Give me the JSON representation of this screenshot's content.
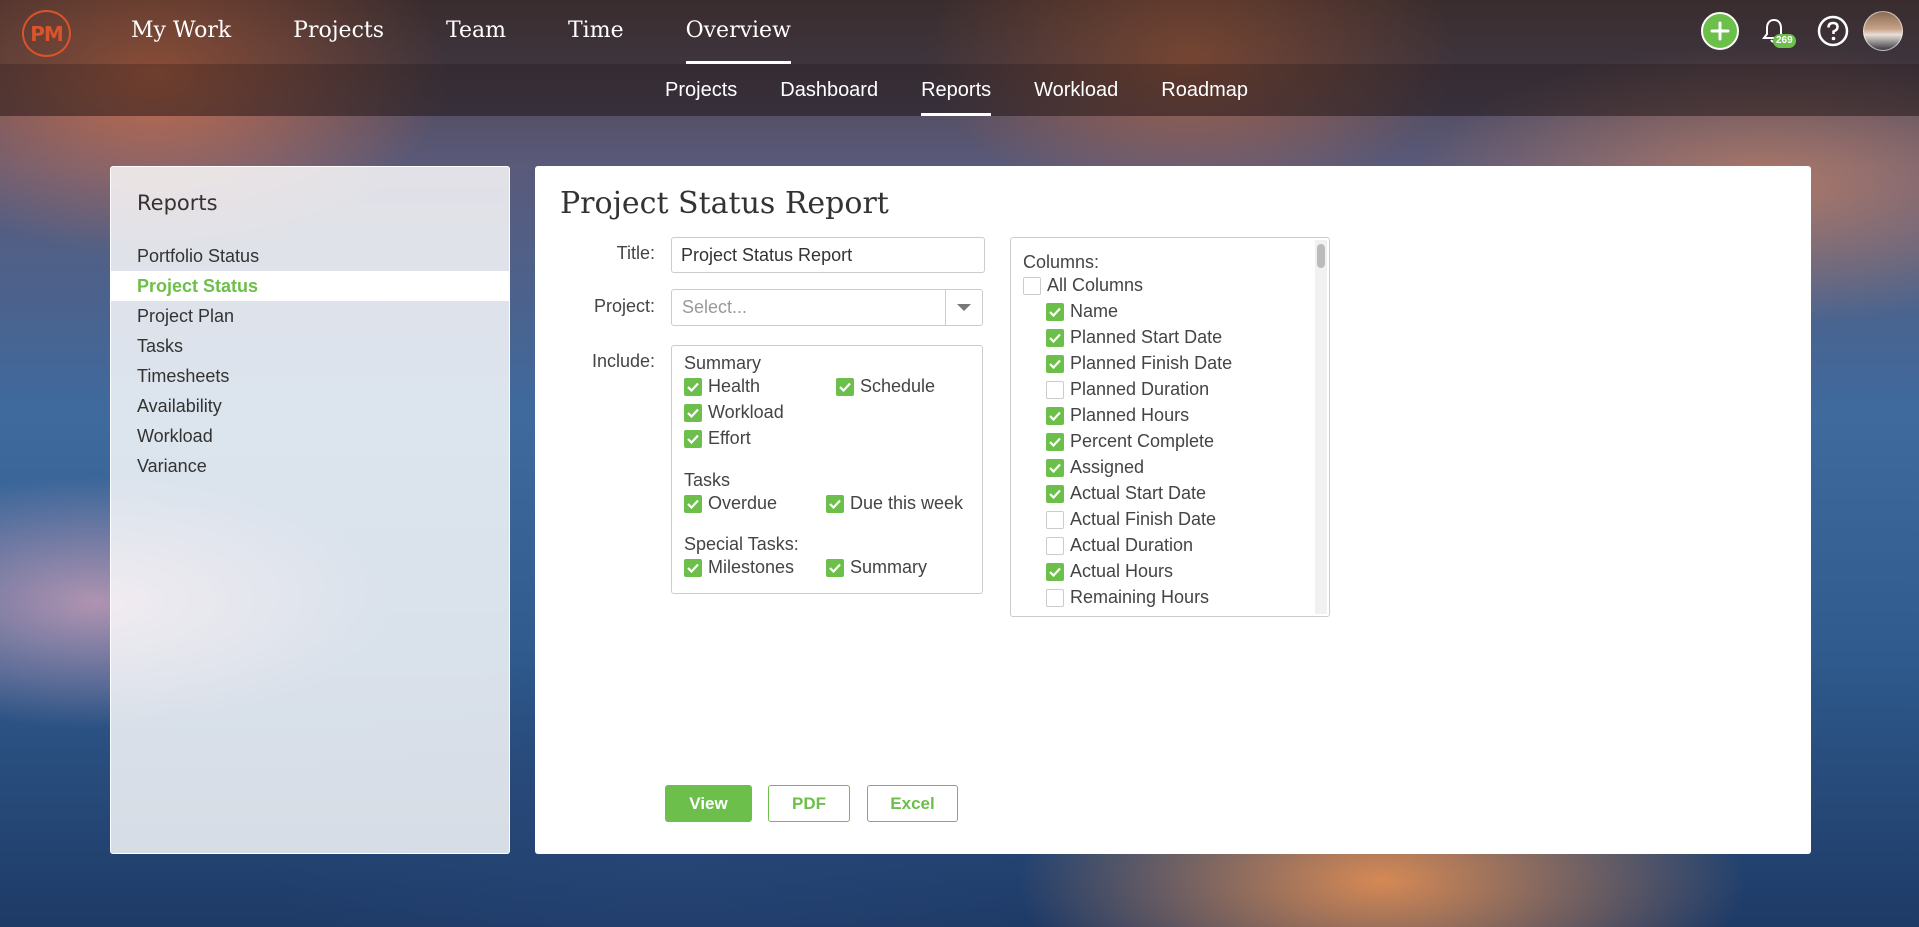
{
  "logo": {
    "text": "PM"
  },
  "main_nav": {
    "items": [
      {
        "label": "My Work",
        "active": false
      },
      {
        "label": "Projects",
        "active": false
      },
      {
        "label": "Team",
        "active": false
      },
      {
        "label": "Time",
        "active": false
      },
      {
        "label": "Overview",
        "active": true
      }
    ]
  },
  "header_icons": {
    "add": "plus-circle-icon",
    "notifications": "bell-icon",
    "notification_count": "269",
    "help": "question-circle-icon",
    "avatar": "user-avatar"
  },
  "sub_nav": {
    "items": [
      {
        "label": "Projects",
        "active": false
      },
      {
        "label": "Dashboard",
        "active": false
      },
      {
        "label": "Reports",
        "active": true
      },
      {
        "label": "Workload",
        "active": false
      },
      {
        "label": "Roadmap",
        "active": false
      }
    ]
  },
  "sidebar": {
    "title": "Reports",
    "items": [
      {
        "label": "Portfolio Status",
        "active": false
      },
      {
        "label": "Project Status",
        "active": true
      },
      {
        "label": "Project Plan",
        "active": false
      },
      {
        "label": "Tasks",
        "active": false
      },
      {
        "label": "Timesheets",
        "active": false
      },
      {
        "label": "Availability",
        "active": false
      },
      {
        "label": "Workload",
        "active": false
      },
      {
        "label": "Variance",
        "active": false
      }
    ]
  },
  "report": {
    "heading": "Project Status Report",
    "title_label": "Title:",
    "title_value": "Project Status Report",
    "project_label": "Project:",
    "project_placeholder": "Select...",
    "include_label": "Include:",
    "groups": {
      "summary": {
        "label": "Summary",
        "items": [
          {
            "label": "Health",
            "checked": true
          },
          {
            "label": "Schedule",
            "checked": true
          },
          {
            "label": "Workload",
            "checked": true
          },
          {
            "label": "Effort",
            "checked": true
          }
        ]
      },
      "tasks": {
        "label": "Tasks",
        "items": [
          {
            "label": "Overdue",
            "checked": true
          },
          {
            "label": "Due this week",
            "checked": true
          }
        ]
      },
      "special": {
        "label": "Special Tasks:",
        "items": [
          {
            "label": "Milestones",
            "checked": true
          },
          {
            "label": "Summary",
            "checked": true
          }
        ]
      }
    },
    "columns": {
      "label": "Columns:",
      "all": {
        "label": "All Columns",
        "checked": false
      },
      "items": [
        {
          "label": "Name",
          "checked": true
        },
        {
          "label": "Planned Start Date",
          "checked": true
        },
        {
          "label": "Planned Finish Date",
          "checked": true
        },
        {
          "label": "Planned Duration",
          "checked": false
        },
        {
          "label": "Planned Hours",
          "checked": true
        },
        {
          "label": "Percent Complete",
          "checked": true
        },
        {
          "label": "Assigned",
          "checked": true
        },
        {
          "label": "Actual Start Date",
          "checked": true
        },
        {
          "label": "Actual Finish Date",
          "checked": false
        },
        {
          "label": "Actual Duration",
          "checked": false
        },
        {
          "label": "Actual Hours",
          "checked": true
        },
        {
          "label": "Remaining Hours",
          "checked": false
        }
      ]
    },
    "buttons": {
      "view": "View",
      "pdf": "PDF",
      "excel": "Excel"
    }
  },
  "colors": {
    "accent": "#6dbf4b",
    "logo": "#d9542a"
  }
}
